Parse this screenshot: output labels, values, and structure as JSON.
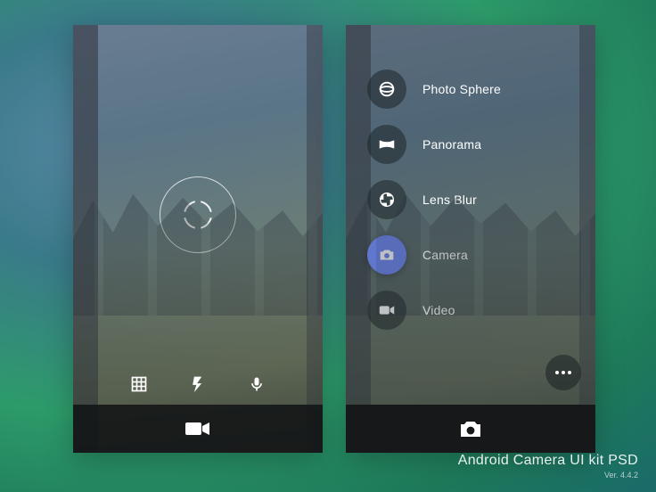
{
  "viewfinder": {
    "quick_controls": [
      "grid",
      "flash",
      "mic"
    ]
  },
  "modes": {
    "items": [
      {
        "key": "photo-sphere",
        "label": "Photo Sphere",
        "icon": "sphere",
        "selected": false
      },
      {
        "key": "panorama",
        "label": "Panorama",
        "icon": "panorama",
        "selected": false
      },
      {
        "key": "lens-blur",
        "label": "Lens Blur",
        "icon": "aperture",
        "selected": false
      },
      {
        "key": "camera",
        "label": "Camera",
        "icon": "camera",
        "selected": true
      },
      {
        "key": "video",
        "label": "Video",
        "icon": "video",
        "selected": false
      }
    ]
  },
  "footer": {
    "title": "Android Camera UI kit PSD",
    "version": "Ver. 4.4.2"
  },
  "colors": {
    "accent": "#6c86f2",
    "bar": "#16181a"
  }
}
